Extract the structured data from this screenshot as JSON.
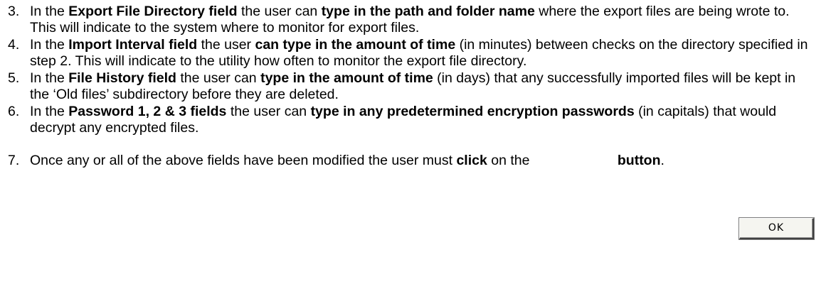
{
  "items": [
    {
      "number": "3.",
      "segments": [
        {
          "t": "In the ",
          "b": false
        },
        {
          "t": "Export File Directory field",
          "b": true
        },
        {
          "t": " the user can ",
          "b": false
        },
        {
          "t": "type in the path and folder name",
          "b": true
        },
        {
          "t": " where the export files are being wrote to. This will indicate to the system where to monitor for export files.",
          "b": false
        }
      ]
    },
    {
      "number": "4.",
      "segments": [
        {
          "t": "In the ",
          "b": false
        },
        {
          "t": "Import Interval field",
          "b": true
        },
        {
          "t": " the user ",
          "b": false
        },
        {
          "t": "can type in the amount of time",
          "b": true
        },
        {
          "t": " (in minutes) between checks on the directory specified in step 2. This will indicate to the utility how often to monitor the export file directory.",
          "b": false
        }
      ]
    },
    {
      "number": "5.",
      "segments": [
        {
          "t": "In the ",
          "b": false
        },
        {
          "t": "File History field",
          "b": true
        },
        {
          "t": " the user can ",
          "b": false
        },
        {
          "t": "type in the amount of time",
          "b": true
        },
        {
          "t": " (in days) that any successfully imported files will be kept in the ‘Old files’ subdirectory before they are deleted.",
          "b": false
        }
      ]
    },
    {
      "number": "6.",
      "segments": [
        {
          "t": "In the ",
          "b": false
        },
        {
          "t": "Password 1, 2 & 3 fields",
          "b": true
        },
        {
          "t": " the user can ",
          "b": false
        },
        {
          "t": "type in any predetermined encryption passwords",
          "b": true
        },
        {
          "t": " (in capitals) that would decrypt any encrypted files.",
          "b": false
        }
      ]
    },
    {
      "number": "7.",
      "segments": [
        {
          "t": "Once any or all of the above fields have been modified the user must ",
          "b": false
        },
        {
          "t": "click",
          "b": true
        },
        {
          "t": " on the ",
          "b": false
        },
        {
          "t": "button",
          "b": true
        },
        {
          "t": ".",
          "b": false
        }
      ]
    }
  ],
  "ok_button": {
    "label": "OK"
  }
}
